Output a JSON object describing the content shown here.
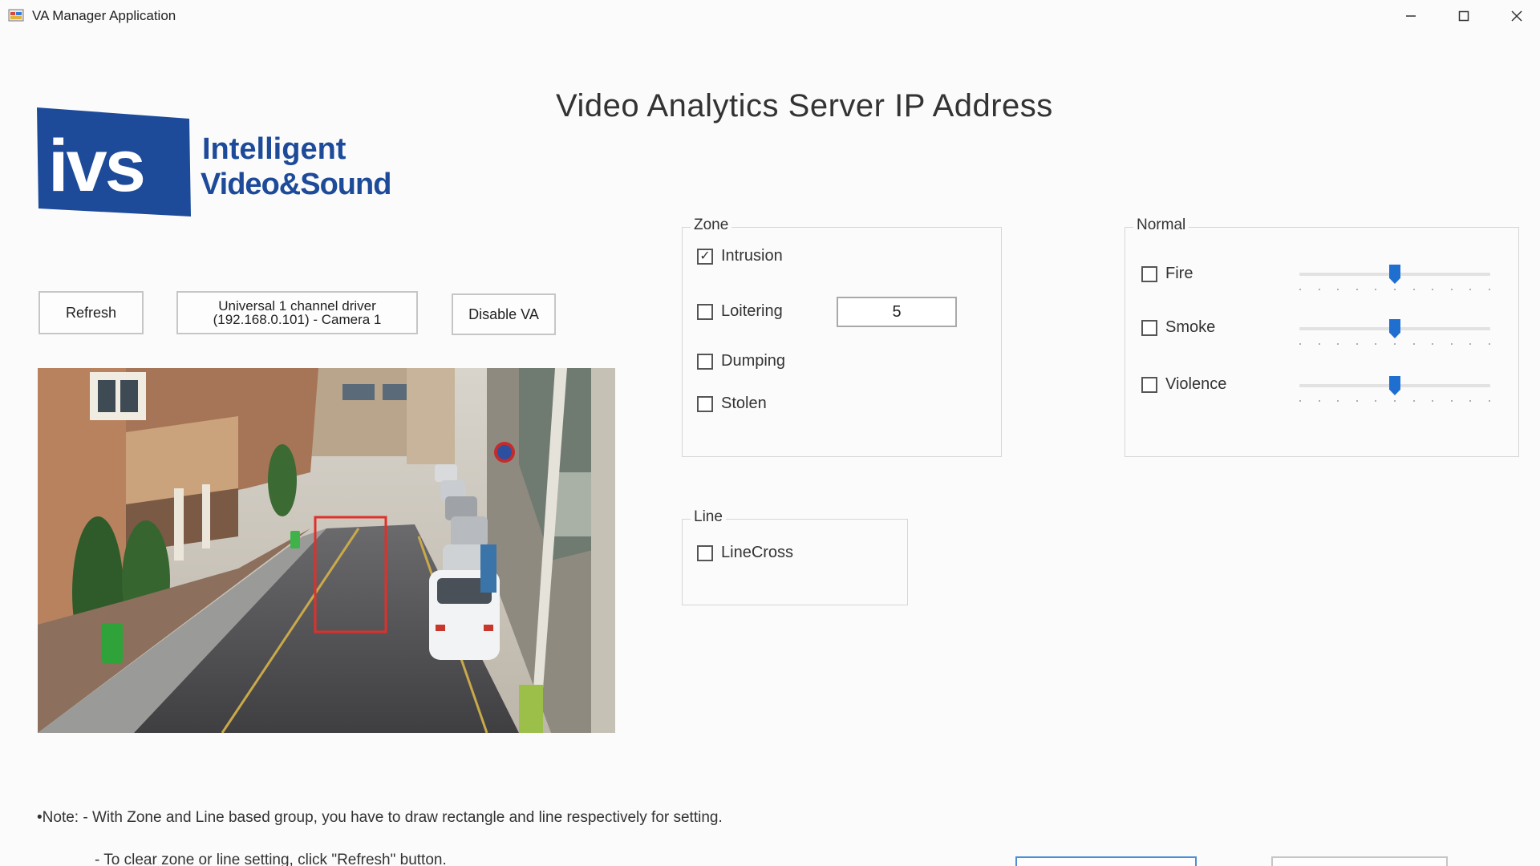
{
  "window": {
    "title": "VA Manager Application",
    "minimize_icon": "minimize-icon",
    "maximize_icon": "maximize-icon",
    "close_icon": "close-icon"
  },
  "logo": {
    "mark": "ivs",
    "line1": "Intelligent",
    "line2": "Video&Sound",
    "brand_color": "#1d4b9a"
  },
  "header": {
    "title": "Video Analytics Server IP Address"
  },
  "toolbar": {
    "refresh_label": "Refresh",
    "camera_line1": "Universal 1 channel driver",
    "camera_line2": "(192.168.0.101) - Camera 1",
    "disable_label": "Disable VA"
  },
  "zone": {
    "legend": "Zone",
    "items": [
      {
        "label": "Intrusion",
        "checked": true
      },
      {
        "label": "Loitering",
        "checked": false
      },
      {
        "label": "Dumping",
        "checked": false
      },
      {
        "label": "Stolen",
        "checked": false
      }
    ],
    "loitering_value": "5"
  },
  "line": {
    "legend": "Line",
    "items": [
      {
        "label": "LineCross",
        "checked": false
      }
    ]
  },
  "normal": {
    "legend": "Normal",
    "items": [
      {
        "label": "Fire",
        "checked": false,
        "level": 0.5
      },
      {
        "label": "Smoke",
        "checked": false,
        "level": 0.5
      },
      {
        "label": "Violence",
        "checked": false,
        "level": 0.5
      }
    ]
  },
  "notes": {
    "line1": "•Note:   -  With Zone and Line based group, you have to draw rectangle and line respectively for setting.",
    "line2": "- To clear zone or line setting, click \"Refresh\" button."
  },
  "colors": {
    "accent": "#1f6fd1",
    "zone_rect": "#e0302a"
  }
}
